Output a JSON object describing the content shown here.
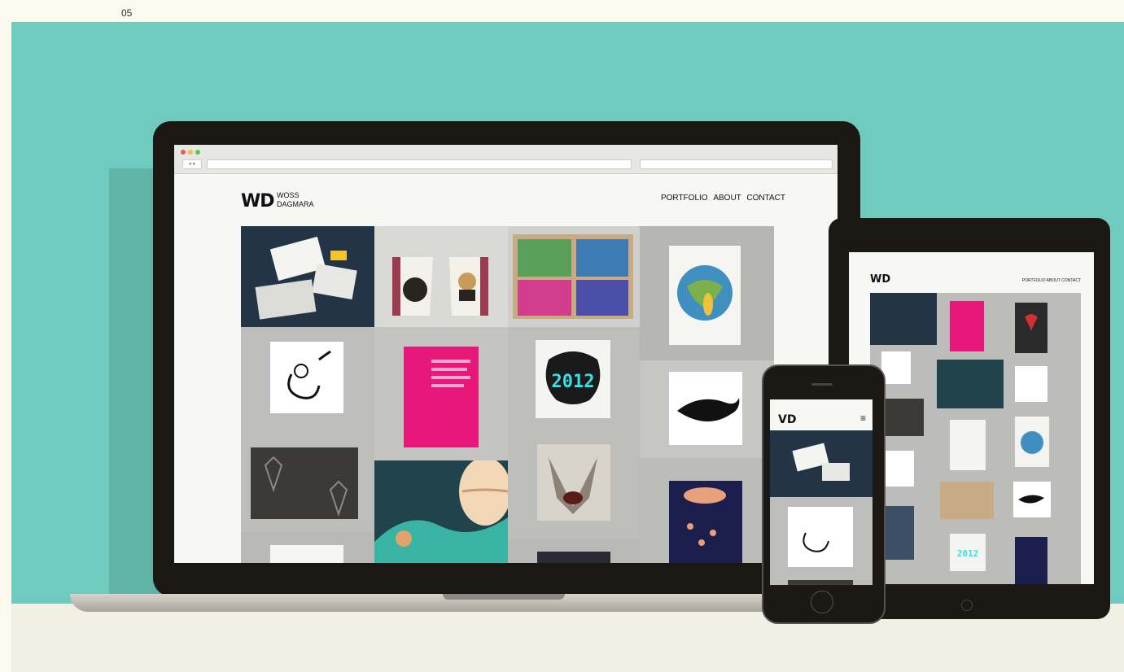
{
  "page": {
    "number": "05",
    "dash": "-"
  },
  "laptop": {
    "logo_mark": "WD",
    "logo_line1": "WOSS",
    "logo_line2": "DAGMARA",
    "nav": [
      "PORTFOLIO",
      "ABOUT",
      "CONTACT"
    ],
    "poster_year": "2012"
  },
  "tablet": {
    "logo_mark": "WD",
    "nav": "PORTFOLIO ABOUT CONTACT",
    "poster_year": "2012"
  },
  "phone": {
    "logo_mark": "VD",
    "menu_icon": "hamburger-icon"
  },
  "colors": {
    "background": "#6fcbbe",
    "floor": "#f2efe4",
    "device_frame": "#1b1712"
  }
}
